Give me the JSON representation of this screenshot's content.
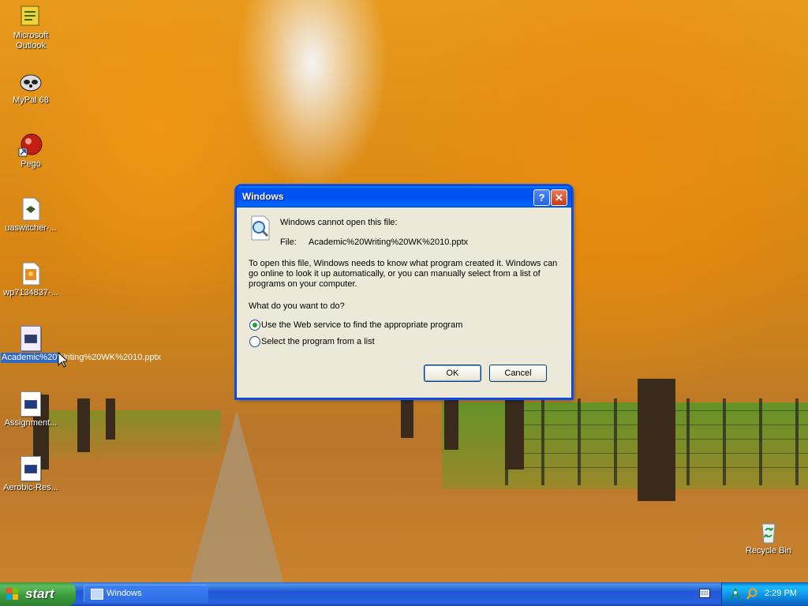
{
  "desktop": {
    "icons": [
      {
        "label": "Microsoft Outlook",
        "icon": "outlook-icon"
      },
      {
        "label": "MyPal 68",
        "icon": "mypal-raccoon-icon"
      },
      {
        "label": "Pego",
        "icon": "pego-red-orb-icon"
      },
      {
        "label": "uaswitcher-...",
        "icon": "file-icon"
      },
      {
        "label": "wp7134837-...",
        "icon": "image-file-icon"
      },
      {
        "label": "Academic%20Writing%20WK%2010.pptx",
        "icon": "pptx-file-icon",
        "selected": true
      },
      {
        "label": "Assignment...",
        "icon": "file-icon"
      },
      {
        "label": "Aerobic-Res...",
        "icon": "file-icon"
      },
      {
        "label": "Recycle Bin",
        "icon": "recycle-bin-icon"
      }
    ]
  },
  "dialog": {
    "title": "Windows",
    "help_glyph": "?",
    "close_glyph": "✕",
    "heading": "Windows cannot open this file:",
    "file_label": "File:",
    "file_name": "Academic%20Writing%20WK%2010.pptx",
    "body": "To open this file, Windows needs to know what program created it.  Windows can go online to look it up automatically, or you can manually select from a list of programs on your computer.",
    "question": "What do you want to do?",
    "options": [
      {
        "label": "Use the Web service to find the appropriate program",
        "selected": true
      },
      {
        "label": "Select the program from a list",
        "selected": false
      }
    ],
    "ok_label": "OK",
    "cancel_label": "Cancel"
  },
  "taskbar": {
    "start_label": "start",
    "window_button_label": "Windows",
    "clock": "2:29 PM"
  },
  "colors": {
    "taskbar_blue": "#2157d7",
    "start_green": "#3a9a3a",
    "title_blue": "#0053ee",
    "selection_blue": "#316ac5",
    "dialog_bg": "#ece9d8"
  }
}
